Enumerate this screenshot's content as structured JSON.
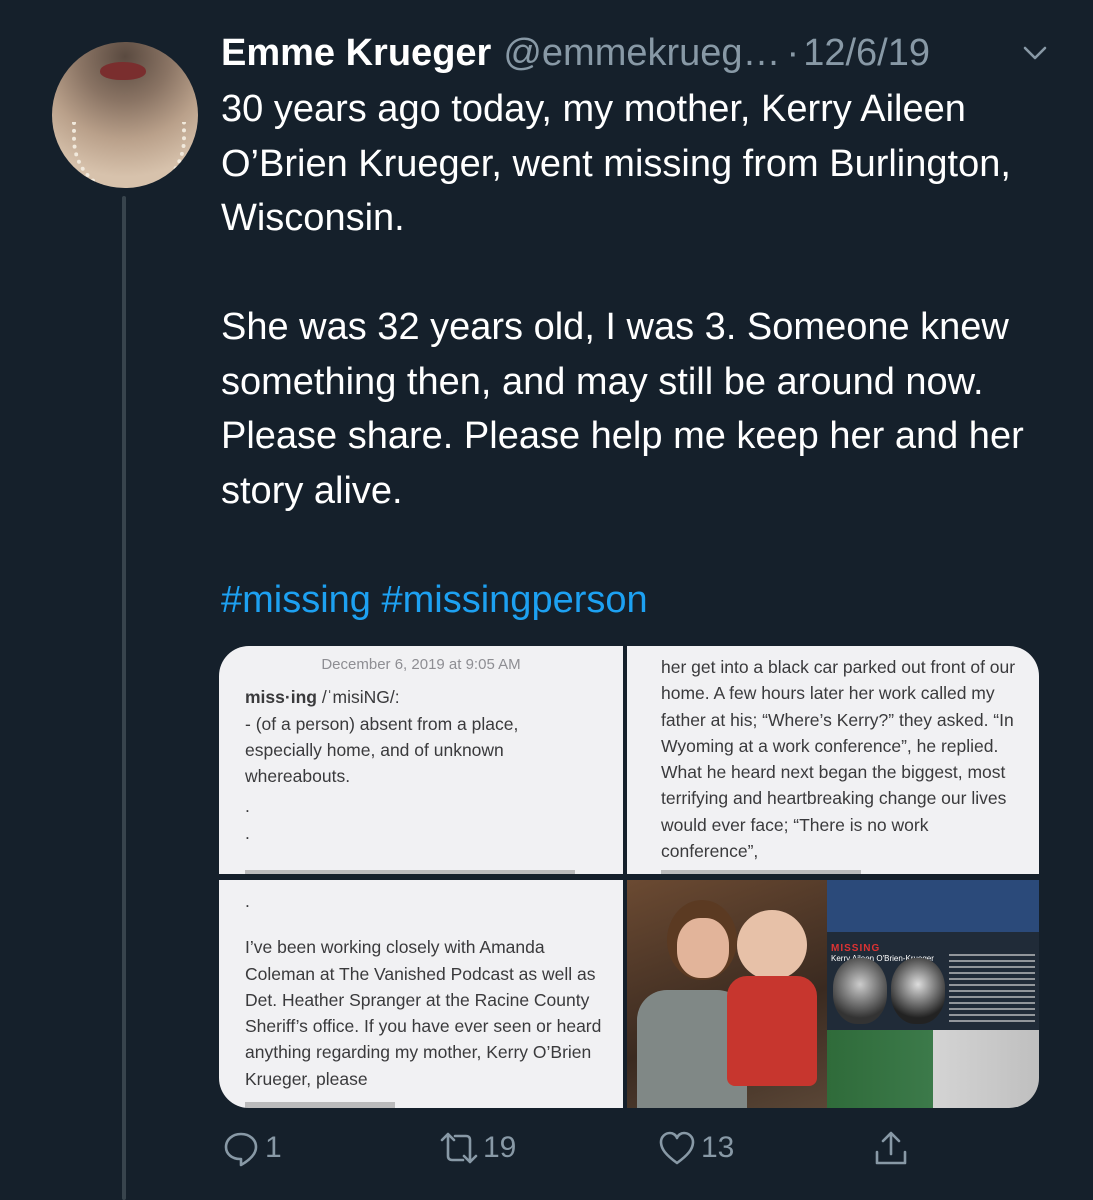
{
  "tweet": {
    "author_name": "Emme Krueger",
    "author_handle": "@emmekrueg…",
    "separator": "·",
    "date": "12/6/19",
    "paragraphs": [
      "30 years ago today, my mother, Kerry Aileen O’Brien Krueger, went missing from Burlington, Wisconsin.",
      "She was 32 years old, I was 3. Someone knew something then, and may still be around now. Please share. Please help me keep her and her story alive."
    ],
    "hashtags": "#missing #missingperson"
  },
  "media": {
    "tile1": {
      "date": "December 6, 2019 at 9:05 AM",
      "headword": "miss·ing",
      "pron": " /ˈmisiNG/:",
      "definition": "- (of a person) absent from a place, especially home, and of unknown whereabouts.",
      "dot1": ".",
      "dot2": "."
    },
    "tile2": {
      "text": "her get into a black car parked out front of our home. A few hours later her work called my father at his; “Where’s Kerry?” they asked. “In Wyoming at a work conference”, he replied. What he heard next began the biggest, most terrifying and heartbreaking change our lives would ever face; “There is no work conference”,"
    },
    "tile3": {
      "dot": ".",
      "text": "I’ve been working closely with Amanda Coleman at The Vanished Podcast as well as Det. Heather Spranger at the Racine County Sheriff’s office. If you have ever seen or heard anything regarding my mother, Kerry O’Brien Krueger, please"
    },
    "tile4": {
      "poster_title": "MISSING",
      "poster_name": "Kerry Aileen O'Brien-Krueger"
    }
  },
  "actions": {
    "replies": "1",
    "retweets": "19",
    "likes": "13"
  },
  "colors": {
    "background": "#15202b",
    "secondary_text": "#8899a6",
    "link": "#1da1f2"
  },
  "icons": [
    "chevron-down-icon",
    "reply-icon",
    "retweet-icon",
    "like-icon",
    "share-icon"
  ]
}
